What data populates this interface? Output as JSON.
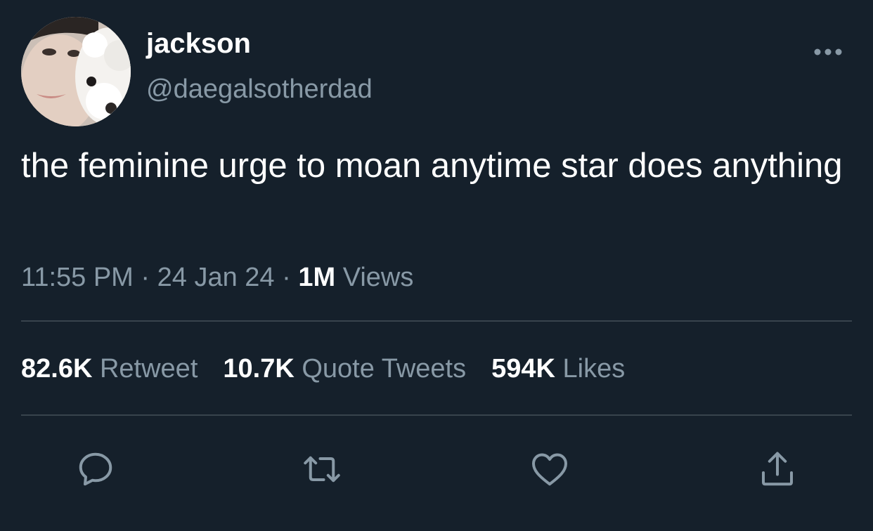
{
  "user": {
    "display_name": "jackson",
    "handle": "@daegalsotherdad"
  },
  "tweet": {
    "text": "the feminine urge to moan anytime star does anything",
    "time": "11:55 PM",
    "separator": " · ",
    "date": "24 Jan 24",
    "views_count": "1M",
    "views_label": "Views"
  },
  "stats": {
    "retweets_count": "82.6K",
    "retweets_label": "Retweet",
    "quotes_count": "10.7K",
    "quotes_label": "Quote Tweets",
    "likes_count": "594K",
    "likes_label": "Likes"
  },
  "actions": {
    "reply_icon": "reply-icon",
    "retweet_icon": "retweet-icon",
    "like_icon": "heart-icon",
    "share_icon": "share-icon"
  },
  "colors": {
    "background": "#15202b",
    "primary_text": "#ffffff",
    "secondary_text": "#8899a6",
    "divider": "#38444d"
  }
}
